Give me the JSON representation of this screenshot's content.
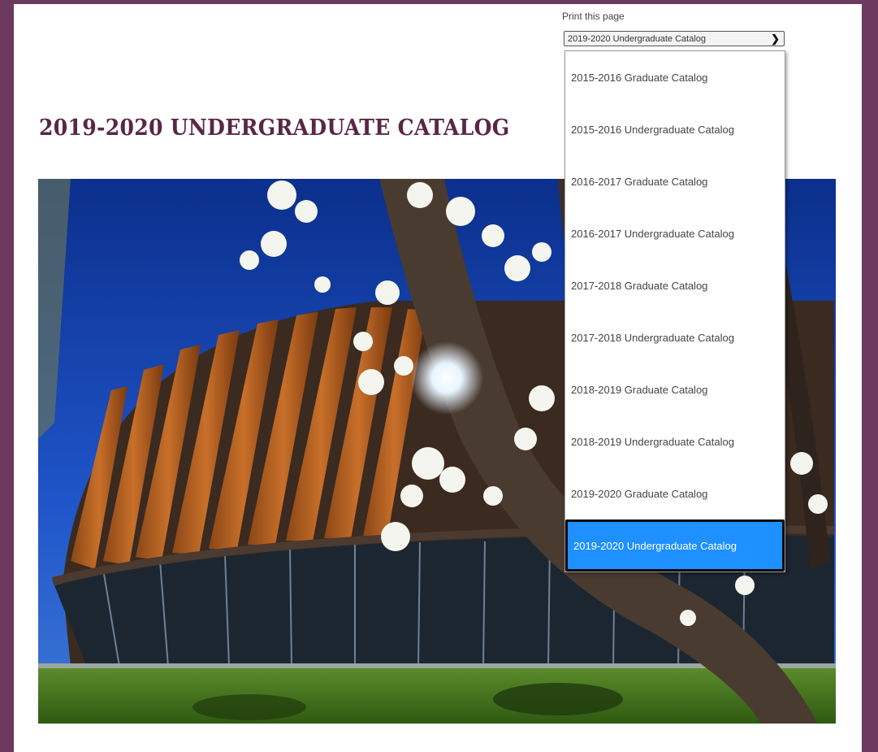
{
  "header": {
    "print_link": "Print this page",
    "select_value": "2019-2020 Undergraduate Catalog"
  },
  "page_title": "2019-2020 UNDERGRADUATE CATALOG",
  "catalog_dropdown": {
    "options": [
      "2015-2016 Graduate Catalog",
      "2015-2016 Undergraduate Catalog",
      "2016-2017 Graduate Catalog",
      "2016-2017 Undergraduate Catalog",
      "2017-2018 Graduate Catalog",
      "2017-2018 Undergraduate Catalog",
      "2018-2019 Graduate Catalog",
      "2018-2019 Undergraduate Catalog",
      "2019-2020 Graduate Catalog",
      "2019-2020 Undergraduate Catalog"
    ],
    "selected_index": 9
  },
  "hero_image": {
    "description_icon": "campus-building-photo"
  },
  "colors": {
    "frame": "#6b3a5e",
    "title": "#5a2745",
    "highlight": "#1e90ff"
  }
}
